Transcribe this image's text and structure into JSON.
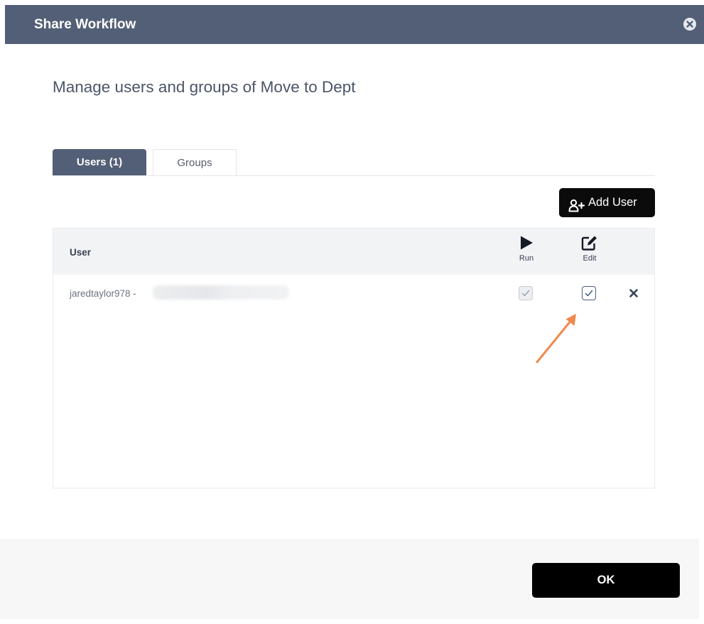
{
  "dialog": {
    "title": "Share Workflow",
    "close_icon": "close-circle-icon"
  },
  "heading": "Manage users and groups of Move to Dept",
  "tabs": [
    {
      "label": "Users (1)",
      "active": true
    },
    {
      "label": "Groups",
      "active": false
    }
  ],
  "toolbar": {
    "add_user_label": "Add User",
    "add_user_icon": "user-plus-icon"
  },
  "table": {
    "columns": {
      "user": "User",
      "run": "Run",
      "edit": "Edit",
      "run_icon": "play-icon",
      "edit_icon": "edit-icon"
    },
    "rows": [
      {
        "user": "jaredtaylor978 -",
        "email_redacted": true,
        "run_checked": true,
        "run_disabled": true,
        "edit_checked": true,
        "remove_icon": "close-icon"
      }
    ]
  },
  "annotation": {
    "arrow_icon": "arrow-icon",
    "arrow_color": "#f0884c"
  },
  "footer": {
    "ok_label": "OK"
  },
  "colors": {
    "header": "#535f76",
    "primary_button": "#000000"
  }
}
